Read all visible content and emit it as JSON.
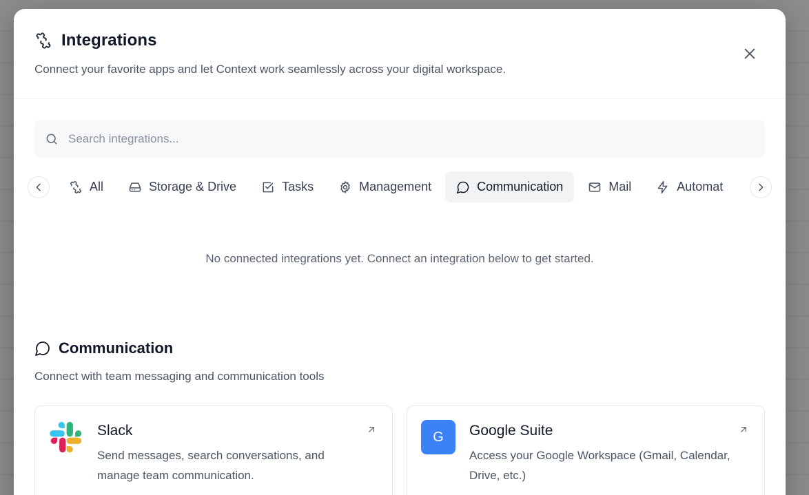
{
  "header": {
    "title": "Integrations",
    "subtitle": "Connect your favorite apps and let Context work seamlessly across your digital workspace.",
    "title_icon": "puzzle-icon",
    "close_icon": "close-icon"
  },
  "search": {
    "placeholder": "Search integrations...",
    "value": ""
  },
  "tabs": [
    {
      "label": "All",
      "icon": "puzzle-icon",
      "active": false
    },
    {
      "label": "Storage & Drive",
      "icon": "hard-drive-icon",
      "active": false
    },
    {
      "label": "Tasks",
      "icon": "checkbox-icon",
      "active": false
    },
    {
      "label": "Management",
      "icon": "gear-icon",
      "active": false
    },
    {
      "label": "Communication",
      "icon": "chat-bubble-icon",
      "active": true
    },
    {
      "label": "Mail",
      "icon": "mail-icon",
      "active": false
    },
    {
      "label": "Automat",
      "icon": "lightning-icon",
      "active": false
    }
  ],
  "empty_state": "No connected integrations yet. Connect an integration below to get started.",
  "section": {
    "title": "Communication",
    "subtitle": "Connect with team messaging and communication tools",
    "icon": "chat-bubble-icon"
  },
  "cards": [
    {
      "name": "Slack",
      "description": "Send messages, search conversations, and manage team communication.",
      "logo": "slack-logo"
    },
    {
      "name": "Google Suite",
      "description": "Access your Google Workspace (Gmail, Calendar, Drive, etc.)",
      "logo_letter": "G",
      "logo_color": "#3b82f6"
    }
  ],
  "colors": {
    "accent": "#3b82f6",
    "active_tab_bg": "#f1f3f5"
  }
}
